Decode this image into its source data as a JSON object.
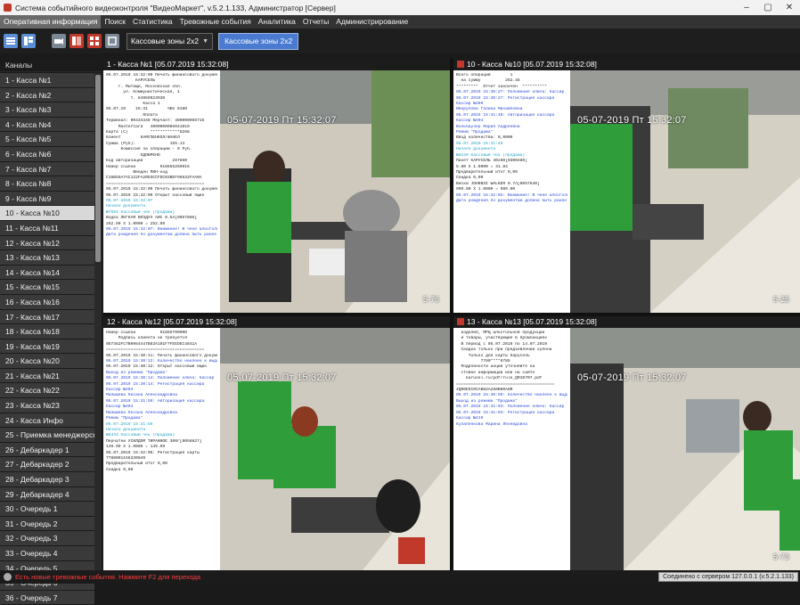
{
  "window": {
    "title": "Система событийного видеоконтроля \"ВидеоМаркет\", v.5.2.1.133, Администратор [Сервер]",
    "minimize": "–",
    "maximize": "▢",
    "close": "✕"
  },
  "menu": [
    "Оперативная информация",
    "Поиск",
    "Статистика",
    "Тревожные события",
    "Аналитика",
    "Отчеты",
    "Администрирование"
  ],
  "toolbar": {
    "layout_select": "Кассовые зоны 2x2",
    "layout_tab": "Кассовые зоны 2x2"
  },
  "sidebar": {
    "header": "Каналы",
    "selected_index": 9,
    "channels": [
      "1 - Касса №1",
      "2 - Касса №2",
      "3 - Касса №3",
      "4 - Касса №4",
      "5 - Касса №5",
      "6 - Касса №6",
      "7 - Касса №7",
      "8 - Касса №8",
      "9 - Касса №9",
      "10 - Касса №10",
      "11 - Касса №11",
      "12 - Касса №12",
      "13 - Касса №13",
      "14 - Касса №14",
      "15 - Касса №15",
      "16 - Касса №16",
      "17 - Касса №17",
      "18 - Касса №18",
      "19 - Касса №19",
      "20 - Касса №20",
      "21 - Касса №21",
      "22 - Касса №22",
      "23 - Касса №23",
      "24 - Касса Инфо",
      "25 - Приемка менеджерская",
      "26 - Дебаркадер 1",
      "27 - Дебаркадер 2",
      "28 - Дебаркадер 3",
      "29 - Дебаркадер 4",
      "30 - Очередь 1",
      "31 - Очередь 2",
      "32 - Очередь 3",
      "33 - Очередь 4",
      "34 - Очередь 5",
      "35 - Очередь 6",
      "36 - Очередь 7"
    ]
  },
  "panes": [
    {
      "title": "1 - Касса №1  [05.07.2019 15:32:08]",
      "timestamp": "05-07-2019 Пт 15:32:07",
      "cam_id": "5-76",
      "receipt": [
        {
          "t": "05.07.2019 15:32:00 Печать финансового документа",
          "c": ""
        },
        {
          "t": "",
          "c": ""
        },
        {
          "t": "            КАРУСЕЛЬ",
          "c": ""
        },
        {
          "t": "     г. Мытищи, Московская обл.",
          "c": ""
        },
        {
          "t": "       ул. Коммунистическая, 1",
          "c": ""
        },
        {
          "t": "          т. 84959923930",
          "c": ""
        },
        {
          "t": "               Касса 1",
          "c": ""
        },
        {
          "t": "05.07.19    15:31        ЧЕК 8180",
          "c": ""
        },
        {
          "t": "               Оплата",
          "c": ""
        },
        {
          "t": "Терминал: 00434348 Мерчант: 400000056715",
          "c": ""
        },
        {
          "t": "     MasterCard   4000000086041010",
          "c": ""
        },
        {
          "t": "Карта (С)         ************8288",
          "c": ""
        },
        {
          "t": "Клиент        КАМУЗЕНКОЛ/ЖАНЕЛ",
          "c": ""
        },
        {
          "t": "Сумма (Руб):              155.13",
          "c": ""
        },
        {
          "t": "      Комиссия за операцию - 0 Руб.",
          "c": ""
        },
        {
          "t": "              ОДОБРЕНО",
          "c": ""
        },
        {
          "t": "Код авторизации            287860",
          "c": ""
        },
        {
          "t": "Номер ссылки          918656260916",
          "c": ""
        },
        {
          "t": "           Введен ПИН-код",
          "c": ""
        },
        {
          "t": "C16BS5A7AC122FA20D3CCFDC03BEF96632FAA0A",
          "c": ""
        },
        {
          "t": "========================================",
          "c": ""
        },
        {
          "t": "",
          "c": ""
        },
        {
          "t": "",
          "c": ""
        },
        {
          "t": "",
          "c": ""
        },
        {
          "t": "05.07.2019 15:32:00 Печать финансового документа",
          "c": ""
        },
        {
          "t": "",
          "c": ""
        },
        {
          "t": "05.07.2019 15:32:00 Открыт кассовый ящик",
          "c": ""
        },
        {
          "t": "",
          "c": ""
        },
        {
          "t": "05.07.2019 15:32:07",
          "c": "cy"
        },
        {
          "t": "Начало документа",
          "c": "cy"
        },
        {
          "t": "№7692 Кассовый чек (продажа)",
          "c": "cy"
        },
        {
          "t": "Водка ЛЕГКАЯ ВОЗДУХ АЙС 0.5л[0057866]",
          "c": ""
        },
        {
          "t": "252.99 X 1.0000 = 252.99",
          "c": ""
        },
        {
          "t": "05.07.2019 15:32:07: Внимание! В чеке алкогольная продукция",
          "c": "blue"
        },
        {
          "t": "Дата рождения по документам должна быть ранее 05.07.2001",
          "c": "blue"
        }
      ]
    },
    {
      "title": "10 - Касса №10  [05.07.2019 15:32:08]",
      "timestamp": "05-07-2019 Пт 15:32:07",
      "cam_id": "5-25",
      "receipt": [
        {
          "t": "Всего операций        1",
          "c": ""
        },
        {
          "t": "  на сумму          252.48",
          "c": ""
        },
        {
          "t": "",
          "c": ""
        },
        {
          "t": "*********  Отчет закончен  **********",
          "c": ""
        },
        {
          "t": "",
          "c": ""
        },
        {
          "t": "",
          "c": ""
        },
        {
          "t": "",
          "c": ""
        },
        {
          "t": "05.07.2019 15:30:27: Положение ключа: Кассир",
          "c": "blue"
        },
        {
          "t": "05.07.2019 15:30:27: Регистрация кассира",
          "c": "blue"
        },
        {
          "t": "Кассир №209",
          "c": "blue"
        },
        {
          "t": "Ивкрупова Галина Михайловна",
          "c": "blue"
        },
        {
          "t": "",
          "c": ""
        },
        {
          "t": "",
          "c": ""
        },
        {
          "t": "05.07.2019 15:31:40: Авторизация кассира",
          "c": "blue"
        },
        {
          "t": "Кассир №404",
          "c": "blue"
        },
        {
          "t": "Вольбаузер Мария Андреевна",
          "c": "blue"
        },
        {
          "t": "",
          "c": ""
        },
        {
          "t": "",
          "c": ""
        },
        {
          "t": "",
          "c": ""
        },
        {
          "t": "Режим \"Продажа\"",
          "c": "blue"
        },
        {
          "t": "Ввод количества: 0,0000",
          "c": ""
        },
        {
          "t": "",
          "c": ""
        },
        {
          "t": "05.07.2019 15:31:48",
          "c": "cy"
        },
        {
          "t": "Начало документа",
          "c": "cy"
        },
        {
          "t": "№8249 Кассовый чек (продажа)",
          "c": "cy"
        },
        {
          "t": "Пакет КАРУСЕЛЬ 40x60[0300480]",
          "c": ""
        },
        {
          "t": "5.80 X 1.0000 = 41.84",
          "c": ""
        },
        {
          "t": "Предварительный итог 0,00",
          "c": ""
        },
        {
          "t": "Скидка 0,00",
          "c": ""
        },
        {
          "t": "Виски JOHNNIE WALKER 0.7л[0057840]",
          "c": ""
        },
        {
          "t": "999.00 X 1.0000 = 999.00",
          "c": ""
        },
        {
          "t": "05.07.2019 15:32:02: Внимание! В чеке алкогольная продукция",
          "c": "blue"
        },
        {
          "t": "Дата рождения по документам должна быть ранее 05.07.2001",
          "c": "blue"
        }
      ]
    },
    {
      "title": "12 - Касса №12  [05.07.2019 15:32:08]",
      "timestamp": "05-07-2019 Пт 15:32:07",
      "cam_id": "",
      "receipt": [
        {
          "t": "Номер ссылки          91865700000",
          "c": ""
        },
        {
          "t": "     Подпись клиента не требуется",
          "c": ""
        },
        {
          "t": "0D7382FC7B0954447B83A101F7FEEDEC4841A",
          "c": ""
        },
        {
          "t": "========================================",
          "c": ""
        },
        {
          "t": "",
          "c": ""
        },
        {
          "t": "",
          "c": ""
        },
        {
          "t": "05.07.2019 15:30:11: Печать финансового документа",
          "c": ""
        },
        {
          "t": "",
          "c": ""
        },
        {
          "t": "05.07.2019 15:30:12: Количество наклеек к выдаче: 1",
          "c": "blue"
        },
        {
          "t": "05.07.2019 15:30:12: Открыт кассовый ящик",
          "c": ""
        },
        {
          "t": "Выход из режима \"Продажа\"",
          "c": "blue"
        },
        {
          "t": "05.07.2019 15:30:14: Положение ключа: Кассир",
          "c": "blue"
        },
        {
          "t": "05.07.2019 15:30:14: Регистрация кассира",
          "c": "blue"
        },
        {
          "t": "Кассир №404",
          "c": "blue"
        },
        {
          "t": "Малышева Оксана Александровна",
          "c": "blue"
        },
        {
          "t": "",
          "c": ""
        },
        {
          "t": "",
          "c": ""
        },
        {
          "t": "05.07.2019 15:31:59: Авторизация кассира",
          "c": "blue"
        },
        {
          "t": "Кассир №404",
          "c": "blue"
        },
        {
          "t": "Малышева Оксана Александровна",
          "c": "blue"
        },
        {
          "t": "",
          "c": ""
        },
        {
          "t": "",
          "c": ""
        },
        {
          "t": "Режим \"Продажа\"",
          "c": "blue"
        },
        {
          "t": "",
          "c": ""
        },
        {
          "t": "",
          "c": ""
        },
        {
          "t": "05.07.2019 15:31:59",
          "c": "cy"
        },
        {
          "t": "Начало документа",
          "c": "cy"
        },
        {
          "t": "№9443 Кассовый чек (продажа)",
          "c": "cy"
        },
        {
          "t": "Перчатки УСИЛДОМ ТИРАЖНОЕ 300г[0056827]",
          "c": ""
        },
        {
          "t": "149.99 X 1.0000 = 149.99",
          "c": ""
        },
        {
          "t": "05.07.2019 15:32:05: Регистрация карты",
          "c": ""
        },
        {
          "t": "7780001156330049",
          "c": ""
        },
        {
          "t": "Предварительный итог 0,00",
          "c": ""
        },
        {
          "t": "Скидка 0,00",
          "c": ""
        }
      ]
    },
    {
      "title": "13 - Касса №13  [05.07.2019 15:32:08]",
      "timestamp": "05-07-2019 Пт 15:32:07",
      "cam_id": "5-73",
      "receipt": [
        {
          "t": "  изделия, МРЦ алкогольной продукции",
          "c": ""
        },
        {
          "t": "",
          "c": ""
        },
        {
          "t": "  и товары, участвующие в промоакциях",
          "c": ""
        },
        {
          "t": "",
          "c": ""
        },
        {
          "t": "",
          "c": ""
        },
        {
          "t": "  В период с 05.07.2019 по 14.07.2019",
          "c": ""
        },
        {
          "t": "",
          "c": ""
        },
        {
          "t": "  Скидка только при предъявлении купона",
          "c": ""
        },
        {
          "t": "",
          "c": ""
        },
        {
          "t": "     Только для карты Карусель",
          "c": ""
        },
        {
          "t": "",
          "c": ""
        },
        {
          "t": "          7780****8785",
          "c": ""
        },
        {
          "t": "",
          "c": ""
        },
        {
          "t": "",
          "c": ""
        },
        {
          "t": "",
          "c": ""
        },
        {
          "t": "  Подробности акции уточняйте на",
          "c": ""
        },
        {
          "t": "",
          "c": ""
        },
        {
          "t": "  стойке информации или на сайте",
          "c": ""
        },
        {
          "t": "",
          "c": ""
        },
        {
          "t": "    karusel.ru/pdf/rule_QR10707.pdf",
          "c": ""
        },
        {
          "t": "",
          "c": ""
        },
        {
          "t": "",
          "c": ""
        },
        {
          "t": "",
          "c": ""
        },
        {
          "t": "========================================",
          "c": ""
        },
        {
          "t": "",
          "c": ""
        },
        {
          "t": "4QR0EEC0CAB82A260B80A0R",
          "c": ""
        },
        {
          "t": "05.07.2019 15:30:59: Количество наклеек к выдаче: 1",
          "c": "blue"
        },
        {
          "t": "Выход из режима \"Продажа\"",
          "c": "blue"
        },
        {
          "t": "05.07.2019 15:31:03: Положение ключа: Кассир",
          "c": "blue"
        },
        {
          "t": "05.07.2019 15:31:04: Регистрация кассира",
          "c": "blue"
        },
        {
          "t": "Кассир №410",
          "c": "blue"
        },
        {
          "t": "Кулапенкова Марина Леонидовна",
          "c": "blue"
        }
      ]
    }
  ],
  "status": {
    "alert": "Есть новые тревожные события. Нажмите F2 для перехода",
    "connection": "Соединено с сервером 127.0.0.1 (v.5.2.1.133)"
  }
}
